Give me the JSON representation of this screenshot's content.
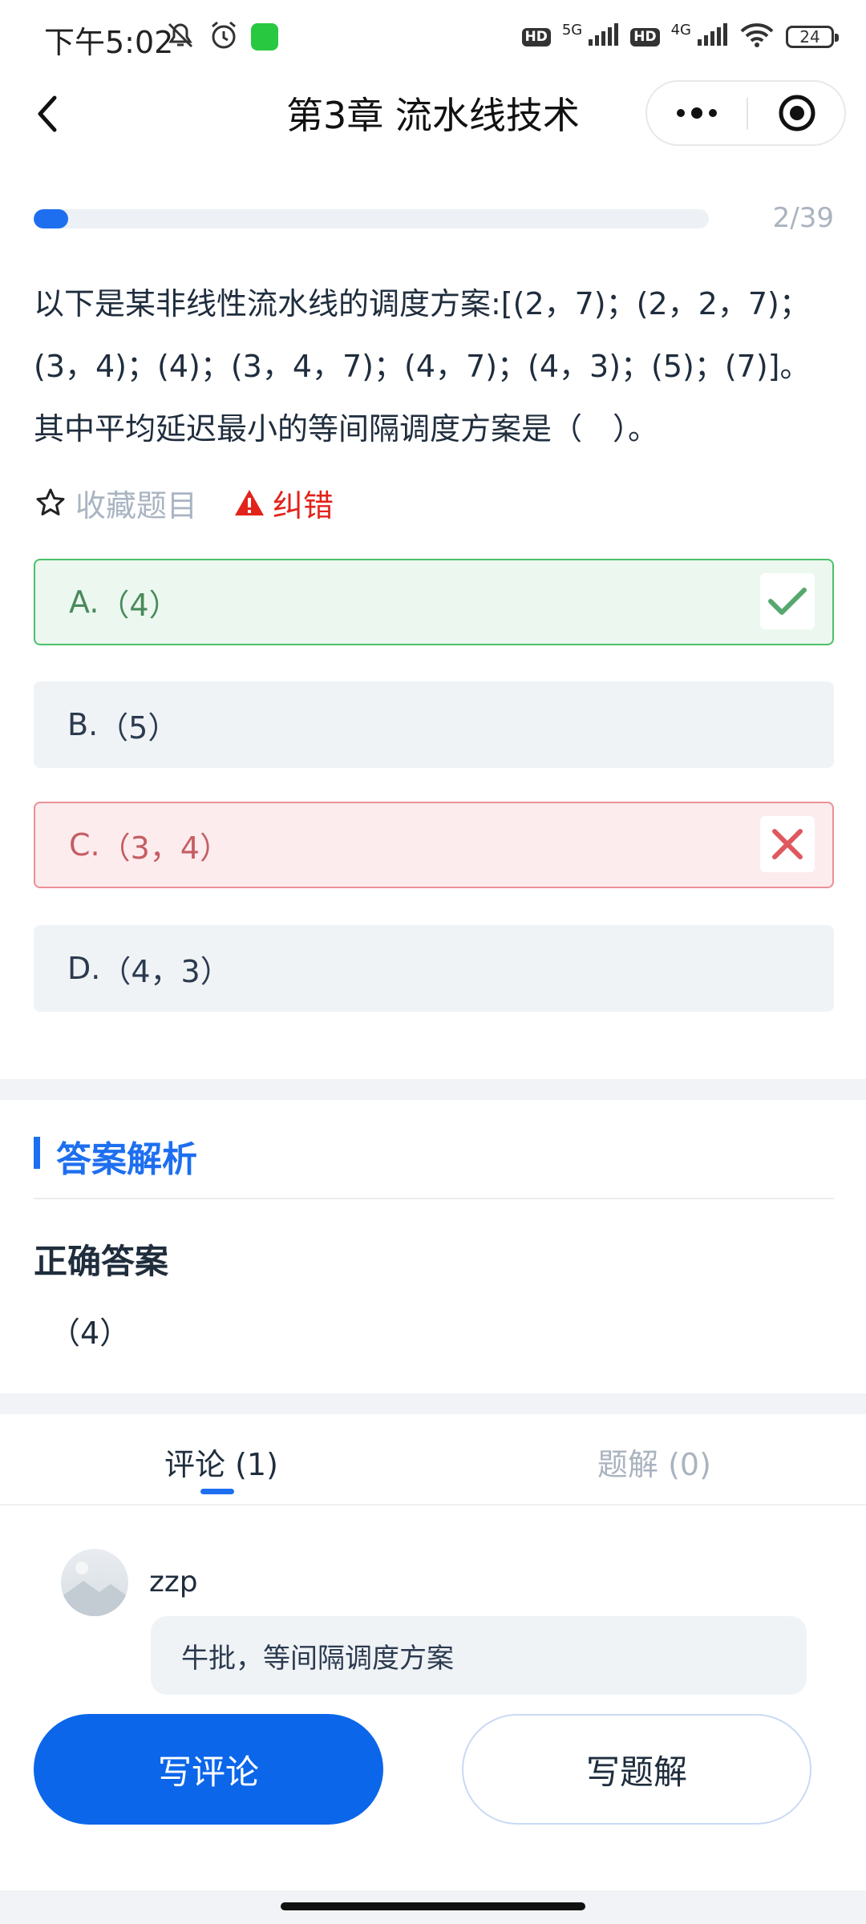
{
  "status_bar": {
    "time": "下午5:02",
    "hd1": "HD",
    "net1": "5G",
    "hd2": "HD",
    "net2": "4G",
    "battery": "24"
  },
  "nav": {
    "title": "第3章  流水线技术"
  },
  "progress": {
    "current": 2,
    "total": 39,
    "label": "2/39"
  },
  "question": {
    "text": "以下是某非线性流水线的调度方案:[(2，7)；(2，2，7)；(3，4)；(4)；(3，4，7)；(4，7)；(4，3)；(5)；(7)]。其中平均延迟最小的等间隔调度方案是（　）。"
  },
  "actions": {
    "favorite_label": "收藏题目",
    "report_label": "纠错"
  },
  "options": [
    {
      "key": "A.",
      "text": "（4）",
      "state": "correct"
    },
    {
      "key": "B.",
      "text": "（5）",
      "state": "none"
    },
    {
      "key": "C.",
      "text": "（3，4）",
      "state": "wrong"
    },
    {
      "key": "D.",
      "text": "（4，3）",
      "state": "none"
    }
  ],
  "analysis": {
    "title": "答案解析",
    "correct_title": "正确答案",
    "correct_value": "（4）"
  },
  "tabs": {
    "comments": "评论 (1)",
    "solutions": "题解 (0)"
  },
  "comment": {
    "user": "zzp",
    "text": "牛批，等间隔调度方案"
  },
  "buttons": {
    "write_comment": "写评论",
    "write_solution": "写题解"
  },
  "colors": {
    "accent": "#1e6ff0",
    "correct": "#4cc06a",
    "wrong": "#ec8f95",
    "report": "#e2231a"
  }
}
